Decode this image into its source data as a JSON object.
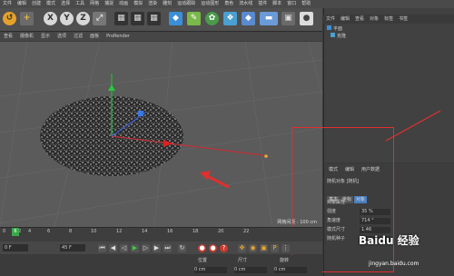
{
  "menubar": [
    "文件",
    "编辑",
    "创建",
    "模式",
    "选择",
    "工具",
    "网格",
    "捕捉",
    "动画",
    "模拟",
    "渲染",
    "雕刻",
    "运动跟踪",
    "运动图形",
    "角色",
    "流水线",
    "插件",
    "脚本",
    "窗口",
    "帮助"
  ],
  "toolbar": {
    "axes": [
      "X",
      "Y",
      "Z"
    ]
  },
  "viewport_menu": [
    "查看",
    "摄像机",
    "显示",
    "选项",
    "过滤",
    "面板",
    "ProRender"
  ],
  "viewport": {
    "grid_label": "网格间距 : 100 cm"
  },
  "right_panel": {
    "tabs": [
      "文件",
      "编辑",
      "查看",
      "对象",
      "标签",
      "书签"
    ],
    "objects": [
      "平面",
      "克隆"
    ]
  },
  "attributes": {
    "tabs": [
      "模式",
      "编辑",
      "用户数据"
    ],
    "object_label": "随机对象 [随机]",
    "subtabs": [
      "基本",
      "坐标",
      "对象"
    ],
    "section": "对象属性",
    "params": [
      {
        "label": "强度",
        "value": "35 %"
      },
      {
        "label": "角速度",
        "value": "714 °"
      },
      {
        "label": "模式尺寸",
        "value": "1.46"
      },
      {
        "label": "随机种子",
        "value": ""
      }
    ]
  },
  "timeline": {
    "ticks": [
      "0",
      "2",
      "4",
      "6",
      "8",
      "10",
      "12",
      "14",
      "16",
      "18",
      "20",
      "22"
    ],
    "current_frame": "6",
    "start_field": "0 F",
    "end_field": "45 F"
  },
  "coords": {
    "headers": [
      "位置",
      "尺寸",
      "旋转"
    ],
    "values": [
      "0 cm",
      "0 cm",
      "0 cm"
    ]
  },
  "watermark": {
    "text": "Baidu 经验",
    "url": "jingyan.baidu.com"
  },
  "colors": {
    "annotation_red": "#e0302e",
    "accent_orange": "#f0a830"
  }
}
